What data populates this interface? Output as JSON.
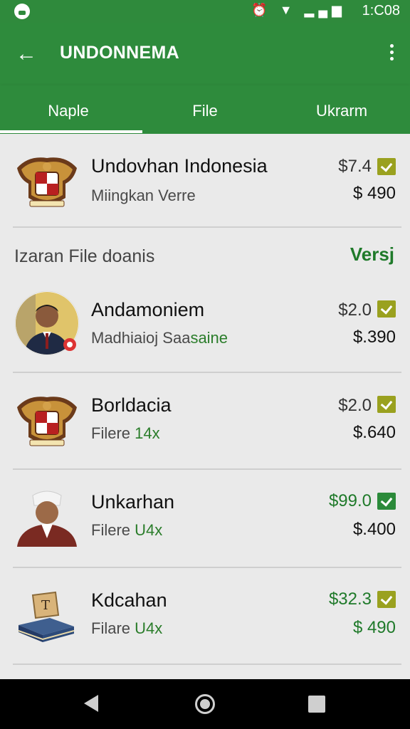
{
  "status_bar": {
    "time": "1:C08",
    "icons": [
      "alarm-icon",
      "wifi-icon",
      "signal-icon",
      "battery-icon"
    ]
  },
  "app_bar": {
    "title": "UNDONNEMA",
    "back_icon": "back-arrow-icon",
    "menu_icon": "more-vert-icon"
  },
  "tabs": [
    {
      "label": "Naple",
      "selected": true
    },
    {
      "label": "File",
      "selected": false
    },
    {
      "label": "Ukrarm",
      "selected": false
    }
  ],
  "section": {
    "title": "Izaran File doanis",
    "action": "Versj"
  },
  "items": [
    {
      "name": "Undovhan Indonesia",
      "subtitle": "Miingkan Verre",
      "subtitle_highlight": "",
      "price": "$7.4",
      "total": "$ 490",
      "price_green": false,
      "icon": "garuda-emblem-icon"
    },
    {
      "name": "Andamoniem",
      "subtitle": "Madhiaioj Saa",
      "subtitle_highlight": "saine",
      "price": "$2.0",
      "total": "$.390",
      "price_green": false,
      "icon": "person-avatar"
    },
    {
      "name": "Borldacia",
      "subtitle": "Filere ",
      "subtitle_highlight": "14x",
      "price": "$2.0",
      "total": "$.640",
      "price_green": false,
      "icon": "garuda-emblem-icon"
    },
    {
      "name": "Unkarhan",
      "subtitle": "Filere ",
      "subtitle_highlight": "U4x",
      "price": "$99.0",
      "total": "$.400",
      "price_green": true,
      "icon": "person-avatar"
    },
    {
      "name": "Kdcahan",
      "subtitle": "Filare ",
      "subtitle_highlight": "U4x",
      "price": "$32.3",
      "total": "$ 490",
      "price_green": true,
      "icon": "book-icon"
    }
  ],
  "colors": {
    "primary": "#2e8b3c",
    "accent_green": "#1f7a2a",
    "check_olive": "#9aa11f"
  }
}
